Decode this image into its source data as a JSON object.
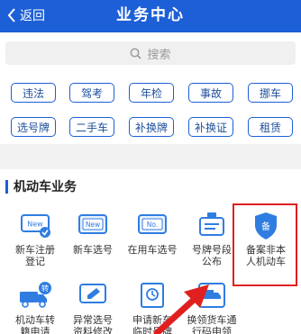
{
  "header": {
    "back_label": "返回",
    "title": "业务中心"
  },
  "search": {
    "placeholder": "搜索"
  },
  "quick_tags": [
    "违法",
    "驾考",
    "年检",
    "事故",
    "挪车",
    "选号牌",
    "二手车",
    "补换牌",
    "补换证",
    "租赁"
  ],
  "section": {
    "title": "机动车业务"
  },
  "services": [
    {
      "line1": "新车注册",
      "line2": "登记",
      "icon": "new-car-register-icon"
    },
    {
      "line1": "新车选号",
      "line2": "",
      "icon": "new-car-plate-icon"
    },
    {
      "line1": "在用车选号",
      "line2": "",
      "icon": "used-car-plate-icon"
    },
    {
      "line1": "号牌号段",
      "line2": "公布",
      "icon": "plate-range-icon"
    },
    {
      "line1": "备案非本",
      "line2": "人机动车",
      "icon": "shield-registration-icon"
    },
    {
      "line1": "机动车转",
      "line2": "籍申请",
      "icon": "truck-transfer-icon"
    },
    {
      "line1": "异常选号",
      "line2": "资料修改",
      "icon": "edit-document-icon"
    },
    {
      "line1": "申请新车",
      "line2": "临时号牌",
      "icon": "temp-plate-icon"
    },
    {
      "line1": "换领货车通",
      "line2": "行码申领",
      "icon": "truck-pass-icon"
    }
  ],
  "colors": {
    "brand": "#1d5fd6",
    "highlight": "#e0201f"
  }
}
